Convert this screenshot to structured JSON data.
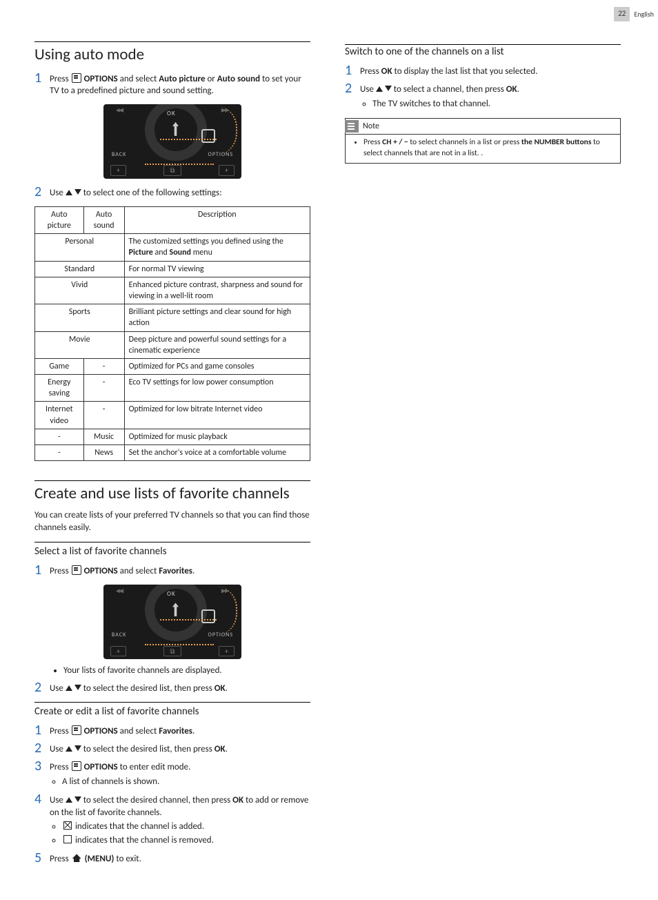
{
  "page": {
    "number": "22",
    "language": "English"
  },
  "left": {
    "sec1": {
      "title": "Using auto mode",
      "step1": {
        "press": "Press ",
        "options": " OPTIONS",
        "mid": " and select ",
        "ap": "Auto picture",
        "or": " or ",
        "as": "Auto sound",
        "tail": " to set your TV to a predefined picture and sound setting."
      },
      "step2": {
        "pre": "Use ",
        "post": " to select one of the following settings:"
      },
      "table": {
        "h1": "Auto picture",
        "h2": "Auto sound",
        "h3": "Description",
        "rows": [
          {
            "ap": "Personal",
            "as": "",
            "span": true,
            "desc_pre": "The customized settings you defined using the ",
            "b1": "Picture",
            "mid": " and ",
            "b2": "Sound",
            "desc_post": " menu"
          },
          {
            "ap": "Standard",
            "as": "",
            "span": true,
            "desc": "For normal TV viewing"
          },
          {
            "ap": "Vivid",
            "as": "",
            "span": true,
            "desc": "Enhanced picture contrast, sharpness and sound for viewing in a well-lit room"
          },
          {
            "ap": "Sports",
            "as": "",
            "span": true,
            "desc": "Brilliant picture settings and clear sound for high action"
          },
          {
            "ap": "Movie",
            "as": "",
            "span": true,
            "desc": "Deep picture and powerful sound settings for a cinematic experience"
          },
          {
            "ap": "Game",
            "as": "-",
            "desc": "Optimized for PCs and game consoles"
          },
          {
            "ap": "Energy saving",
            "as": "-",
            "desc": "Eco TV settings for low power consumption"
          },
          {
            "ap": "Internet video",
            "as": "-",
            "desc": "Optimized for low bitrate Internet video"
          },
          {
            "ap": "-",
            "as": "Music",
            "desc": "Optimized for music playback"
          },
          {
            "ap": "-",
            "as": "News",
            "desc": "Set the anchor's voice at a comfortable volume"
          }
        ]
      }
    },
    "sec2": {
      "title": "Create and use lists of favorite channels",
      "intro": "You can create lists of your preferred TV channels so that you can find those channels easily.",
      "sub1": {
        "title": "Select a list of favorite channels",
        "s1": {
          "press": "Press ",
          "options": " OPTIONS",
          "mid": " and select ",
          "fav": "Favorites",
          "dot": "."
        },
        "bullet": "Your lists of favorite channels are displayed.",
        "s2": {
          "pre": "Use ",
          "mid": " to select the desired list, then press ",
          "ok": "OK",
          "dot": "."
        }
      },
      "sub2": {
        "title": "Create or edit a list of favorite channels",
        "s1": {
          "press": "Press ",
          "options": " OPTIONS",
          "mid": " and select ",
          "fav": "Favorites",
          "dot": "."
        },
        "s2": {
          "pre": "Use ",
          "mid": " to select the desired list, then press ",
          "ok": "OK",
          "dot": "."
        },
        "s3": {
          "press": "Press ",
          "options": " OPTIONS",
          "tail": " to enter edit mode.",
          "bullet": "A list of channels is shown."
        },
        "s4": {
          "pre": "Use ",
          "mid": " to select the desired channel, then press ",
          "ok": "OK",
          "tail": " to add or remove on the list of favorite channels.",
          "b1": " indicates that the channel is added.",
          "b2": " indicates that the channel is removed."
        },
        "s5": {
          "press": "Press ",
          "menu": " (MENU)",
          "tail": " to exit."
        }
      }
    }
  },
  "right": {
    "sub": {
      "title": "Switch to one of the channels on a list",
      "s1": {
        "press": "Press ",
        "ok": "OK",
        "tail": " to display the last list that you selected."
      },
      "s2": {
        "pre": "Use ",
        "mid": " to select a channel, then press ",
        "ok": "OK",
        "dot": ".",
        "bullet": "The TV switches to that channel."
      },
      "note": {
        "title": "Note",
        "pre": "Press ",
        "ch": "CH + / −",
        "mid": " to select channels in a list or press ",
        "nb": "the NUMBER buttons",
        "tail": " to select channels that are not in a list. ."
      }
    }
  }
}
